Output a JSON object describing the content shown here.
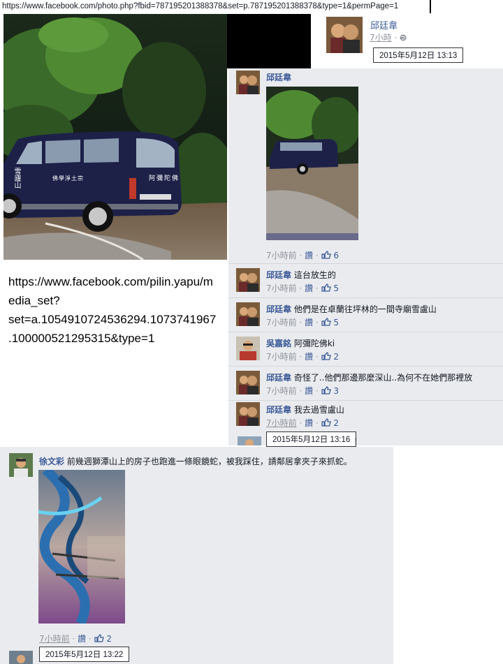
{
  "url_bar": "https://www.facebook.com/photo.php?fbid=787195201388378&set=p.787195201388378&type=1&permPage=1",
  "post": {
    "author": "邱廷韋",
    "time": "7小時",
    "sep": "·",
    "tooltip": "2015年5月12日 13:13"
  },
  "linked_url": [
    "https://www.facebook.com/pilin.yapu/m",
    "edia_set?",
    "set=a.1054910724536294.1073741967",
    ".100000521295315&type=1"
  ],
  "van_text": {
    "left": "雪廬山",
    "right": "阿彌陀佛",
    "center": "佛學淨土宗"
  },
  "comments": [
    {
      "author": "邱廷韋",
      "text": "",
      "time": "7小時前",
      "like": "讚",
      "count": "6"
    },
    {
      "author": "邱廷韋",
      "text": "這台放生的",
      "time": "7小時前",
      "like": "讚",
      "count": "5"
    },
    {
      "author": "邱廷韋",
      "text": "他們是在卓蘭往坪林的一間寺廟雪盧山",
      "time": "7小時前",
      "like": "讚",
      "count": "5"
    },
    {
      "author": "吳嘉銘",
      "text": "阿彌陀佛ki",
      "time": "7小時前",
      "like": "讚",
      "count": "2"
    },
    {
      "author": "邱廷韋",
      "text": "奇怪了..他們那邊那麼深山..為何不在她們那裡放",
      "time": "7小時前",
      "like": "讚",
      "count": "3"
    },
    {
      "author": "邱廷韋",
      "text": "我去過雪盧山",
      "time": "7小時前",
      "like": "讚",
      "count": "2"
    }
  ],
  "comment_tooltip": "2015年5月12日 13:16",
  "comment_trailing": "!",
  "bottom_comment": {
    "author": "徐文彩",
    "text": "前幾週獅潭山上的房子也跑進一條眼鏡蛇，被我踩住，請鄰居拿夾子來抓蛇。",
    "time": "7小時前",
    "like": "讚",
    "count": "2",
    "tooltip": "2015年5月12日 13:22"
  },
  "colors": {
    "link": "#3b5998",
    "meta": "#90949c",
    "panel": "#e9ebee"
  }
}
